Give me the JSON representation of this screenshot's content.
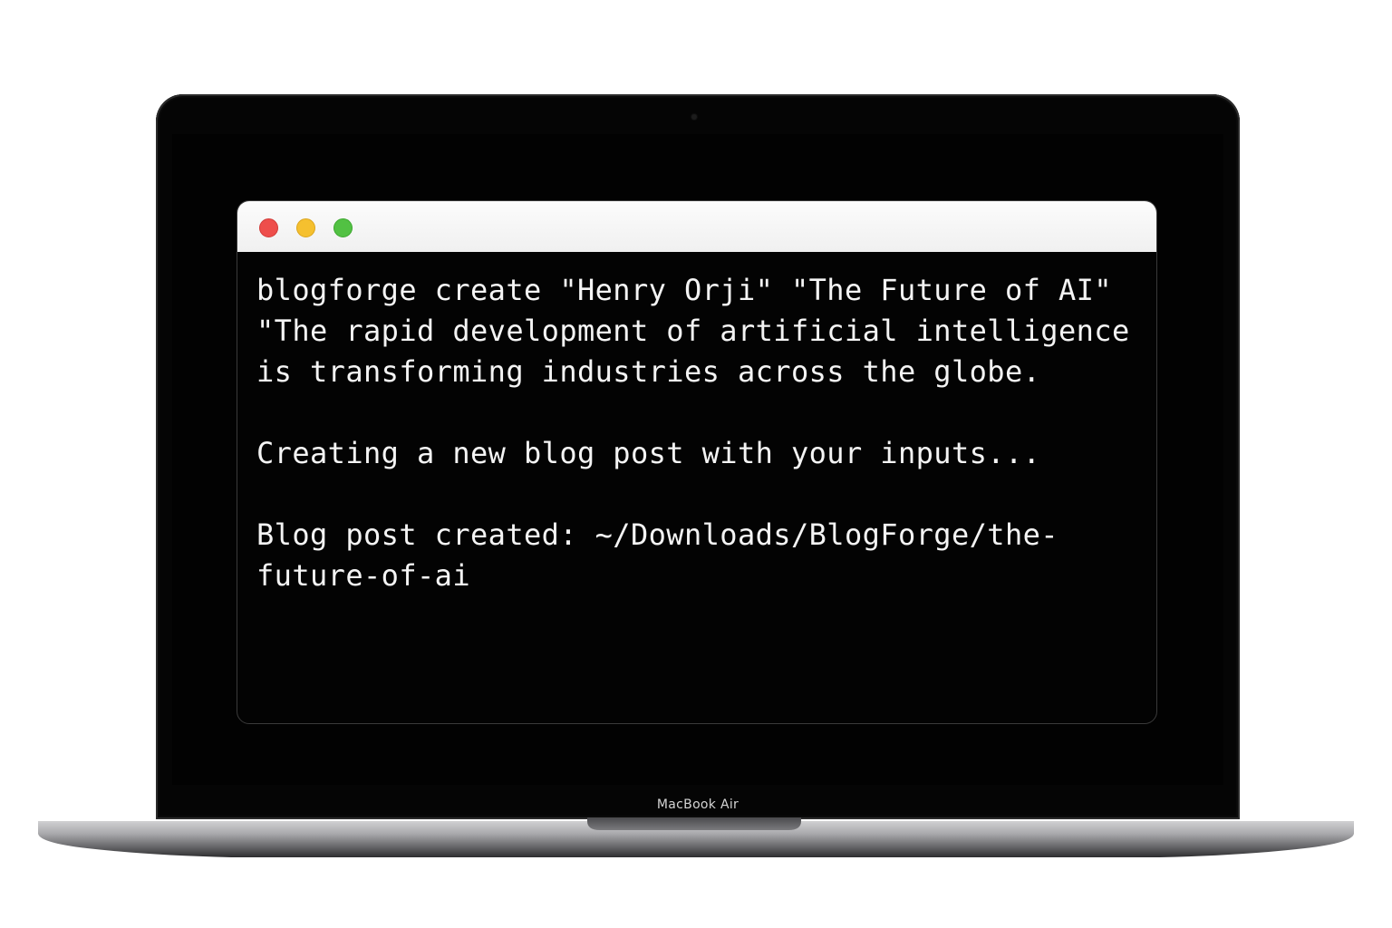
{
  "device": {
    "model_label": "MacBook Air"
  },
  "terminal": {
    "buttons": {
      "close": "close",
      "minimize": "minimize",
      "zoom": "zoom"
    },
    "command_lines": [
      "blogforge create \"Henry Orji\" \"The Future of AI\"",
      "\"The rapid development of artificial intelligence",
      "is transforming industries across the globe."
    ],
    "status_line": "Creating a new blog post with your inputs...",
    "result_lines": [
      "Blog post created: ~/Downloads/BlogForge/the-",
      "future-of-ai"
    ]
  },
  "colors": {
    "close": "#ee4e4b",
    "minimize": "#f5c02f",
    "zoom": "#52c143",
    "terminal_bg": "#030303",
    "terminal_text": "#f4f4f4",
    "titlebar_bg": "#f5f5f5"
  }
}
